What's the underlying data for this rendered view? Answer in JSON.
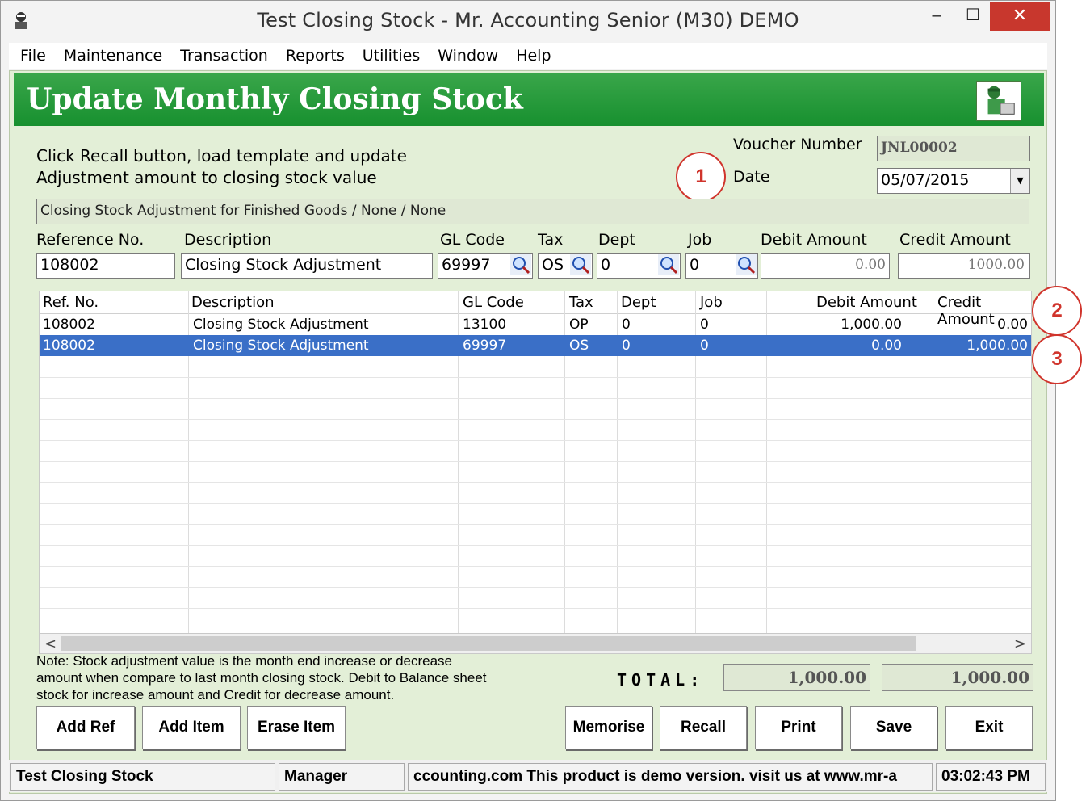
{
  "window": {
    "title": "Test Closing Stock - Mr. Accounting Senior (M30) DEMO",
    "controls": {
      "minimize": "–",
      "maximize": "☐",
      "close": "✕"
    }
  },
  "menubar": {
    "items": [
      "File",
      "Maintenance",
      "Transaction",
      "Reports",
      "Utilities",
      "Window",
      "Help"
    ]
  },
  "header": {
    "title": "Update Monthly Closing Stock"
  },
  "instructions": {
    "line1": "Click Recall button, load template and  update",
    "line2": "Adjustment amount to closing stock value"
  },
  "voucher": {
    "number_label": "Voucher Number",
    "number": "JNL00002",
    "date_label": "Date",
    "date": "05/07/2015"
  },
  "memo": "Closing Stock Adjustment for Finished Goods / None / None",
  "entry": {
    "labels": {
      "reference": "Reference No.",
      "description": "Description",
      "gl_code": "GL Code",
      "tax": "Tax",
      "dept": "Dept",
      "job": "Job",
      "debit": "Debit Amount",
      "credit": "Credit Amount"
    },
    "values": {
      "reference": "108002",
      "description": "Closing Stock Adjustment",
      "gl_code": "69997",
      "tax": "OS",
      "dept": "0",
      "job": "0",
      "debit": "0.00",
      "credit": "1000.00"
    }
  },
  "grid": {
    "columns": [
      "Ref. No.",
      "Description",
      "GL Code",
      "Tax",
      "Dept",
      "Job",
      "Debit Amount",
      "Credit Amount"
    ],
    "rows": [
      {
        "ref": "108002",
        "description": "Closing Stock Adjustment",
        "gl": "13100",
        "tax": "OP",
        "dept": "0",
        "job": "0",
        "debit": "1,000.00",
        "credit": "0.00"
      },
      {
        "ref": "108002",
        "description": "Closing Stock Adjustment",
        "gl": "69997",
        "tax": "OS",
        "dept": "0",
        "job": "0",
        "debit": "0.00",
        "credit": "1,000.00"
      }
    ],
    "selected_row": 1
  },
  "note": "Note: Stock adjustment value is the month end increase or decrease amount when compare to last month closing stock. Debit to Balance sheet stock for increase amount and Credit for decrease amount.",
  "totals": {
    "label": "TOTAL:",
    "debit": "1,000.00",
    "credit": "1,000.00"
  },
  "buttons": {
    "add_ref": "Add Ref",
    "add_item": "Add Item",
    "erase_item": "Erase Item",
    "memorise": "Memorise",
    "recall": "Recall",
    "print": "Print",
    "save": "Save",
    "exit": "Exit"
  },
  "callouts": [
    "1",
    "2",
    "3"
  ],
  "statusbar": {
    "company": "Test Closing Stock",
    "user": "Manager",
    "message": "ccounting.com This product is demo version.  visit us at www.mr-a",
    "time": "03:02:43 PM"
  },
  "colors": {
    "header_green": "#17902f",
    "form_bg": "#e3efd7",
    "selection": "#3a6fc7",
    "callout_red": "#d0342c",
    "close_red": "#c8372d"
  }
}
